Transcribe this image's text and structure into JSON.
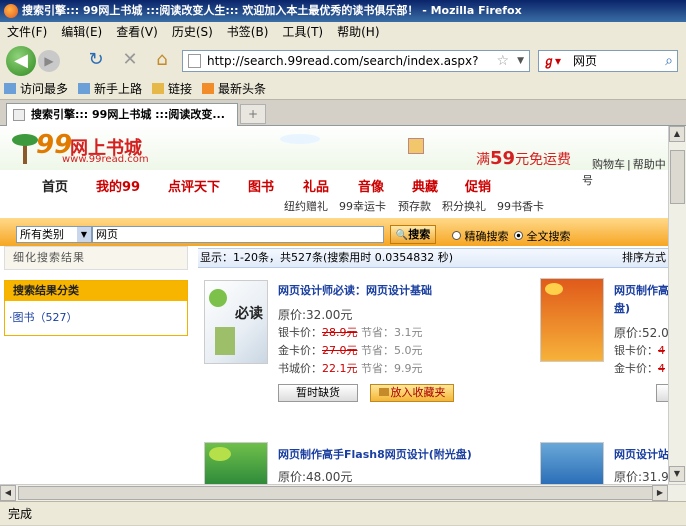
{
  "window": {
    "title": "搜索引擎::: 99网上书城 :::阅读改变人生::: 欢迎加入本土最优秀的读书俱乐部！ - Mozilla Firefox"
  },
  "menu": [
    "文件(F)",
    "编辑(E)",
    "查看(V)",
    "历史(S)",
    "书签(B)",
    "工具(T)",
    "帮助(H)"
  ],
  "toolbar": {
    "url": "http://search.99read.com/search/index.aspx?",
    "search_value": "网页"
  },
  "bookmarks": [
    "访问最多",
    "新手上路",
    "链接",
    "最新头条"
  ],
  "tab": {
    "label": "搜索引擎::: 99网上书城 :::阅读改变...",
    "new_tab": "+"
  },
  "site": {
    "logo_text": "网上书城",
    "logo_url": "www.99read.com",
    "shipping_prefix": "满",
    "shipping_amount": "59",
    "shipping_suffix": "元免运费",
    "cart": "购物车",
    "help": "帮助中",
    "help_tail": "号",
    "nav": [
      "首页",
      "我的99",
      "点评天下",
      "图书",
      "礼品",
      "音像",
      "典藏",
      "促销"
    ],
    "subnav": [
      "纽约赠礼",
      "99幸运卡",
      "预存款",
      "积分换礼",
      "99书香卡"
    ],
    "search": {
      "category": "所有类别",
      "query": "网页",
      "button": "搜索",
      "option_exact": "精确搜索",
      "option_full": "全文搜索"
    },
    "left": {
      "refine_title": "细化搜索结果",
      "category_title": "搜索结果分类",
      "category_item": "·图书（527）"
    },
    "result_summary": "显示：1-20条，共527条(搜索用时 0.0354832 秒)",
    "sort_label": "排序方式",
    "books": [
      {
        "title": "网页设计师必读：网页设计基础",
        "orig_price": "原价:32.00元",
        "silver_label": "银卡价：",
        "silver_price": "28.9元",
        "silver_save": "节省：3.1元",
        "gold_label": "金卡价：",
        "gold_price": "27.0元",
        "gold_save": "节省：5.0元",
        "city_label": "书城价：",
        "city_price": "22.1元",
        "city_save": "节省：9.9元",
        "btn_stock": "暂时缺货",
        "btn_fav": "放入收藏夹"
      },
      {
        "title": "网页制作高手Flash8网页设计(附光盘)",
        "orig_price": "原价:48.00元"
      }
    ],
    "right_books": [
      {
        "title_line1": "网页制作高",
        "title_line2": "盘)",
        "orig_price": "原价:52.0",
        "silver_label": "银卡价：",
        "silver_frag": "4",
        "gold_label": "金卡价：",
        "gold_frag": "4"
      },
      {
        "title_line1": "网页设计站",
        "orig_price": "原价:31.9"
      }
    ]
  },
  "status": "完成",
  "colors": {
    "title_bar": "#0a246a",
    "nav_red": "#cc0000",
    "search_orange": "#f6a623",
    "category_header": "#f7b500"
  }
}
